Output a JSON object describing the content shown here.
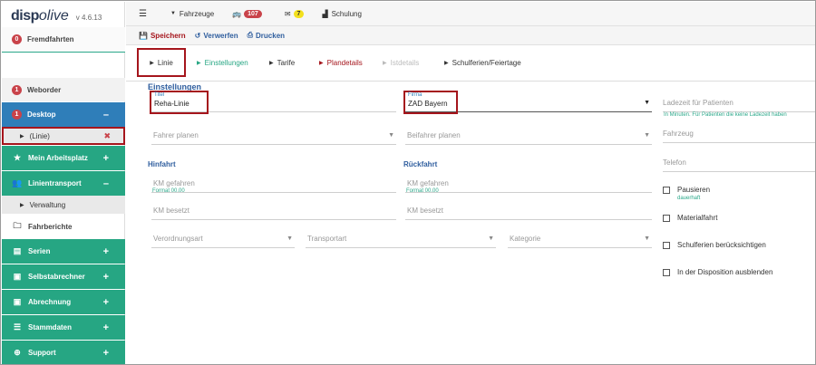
{
  "app": {
    "logo_disp": "disp",
    "logo_live": "olive",
    "version": "v 4.6.13"
  },
  "sidebar": {
    "fremdfahrten": {
      "badge": "0",
      "label": "Fremdfahrten"
    },
    "weborder": {
      "badge": "1",
      "label": "Weborder"
    },
    "desktop": {
      "badge": "1",
      "label": "Desktop",
      "toggle": "–"
    },
    "desktop_sub": {
      "label": "(Linie)",
      "close": "✖"
    },
    "mein_arbeitsplatz": {
      "label": "Mein Arbeitsplatz",
      "toggle": "+"
    },
    "linientransport": {
      "label": "Linientransport",
      "toggle": "–"
    },
    "verwaltung": {
      "label": "Verwaltung"
    },
    "fahrberichte": {
      "label": "Fahrberichte"
    },
    "serien": {
      "label": "Serien",
      "toggle": "+"
    },
    "selbstabrechner": {
      "label": "Selbstabrechner",
      "toggle": "+"
    },
    "abrechnung": {
      "label": "Abrechnung",
      "toggle": "+"
    },
    "stammdaten": {
      "label": "Stammdaten",
      "toggle": "+"
    },
    "support": {
      "label": "Support",
      "toggle": "+"
    }
  },
  "topbar": {
    "fahrzeuge": "Fahrzeuge",
    "bus_count": "107",
    "mail_count": "7",
    "schulung": "Schulung"
  },
  "actions": {
    "save": "Speichern",
    "discard": "Verwerfen",
    "print": "Drucken"
  },
  "tabs": {
    "linie": "Linie",
    "einstellungen": "Einstellungen",
    "tarife": "Tarife",
    "plandetails": "Plandetails",
    "istdetails": "Istdetails",
    "schulferien": "Schulferien/Feiertage"
  },
  "form": {
    "section_title": "Einstellungen",
    "titel_label": "Titel",
    "titel_value": "Reha-Linie",
    "firma_label": "Firma",
    "firma_value": "ZAD Bayern",
    "ladezeit_placeholder": "Ladezeit für Patienten",
    "ladezeit_hint": "In Minuten. Für Patienten die keine Ladezeit haben",
    "fahrer_placeholder": "Fahrer planen",
    "beifahrer_placeholder": "Beifahrer planen",
    "fahrzeug_placeholder": "Fahrzeug",
    "telefon_placeholder": "Telefon",
    "hinfahrt_title": "Hinfahrt",
    "rueckfahrt_title": "Rückfahrt",
    "km_gefahren_placeholder": "KM gefahren",
    "format_hint": "Format 00.00",
    "km_besetzt_placeholder": "KM besetzt",
    "verordnungsart_placeholder": "Verordnungsart",
    "transportart_placeholder": "Transportart",
    "kategorie_placeholder": "Kategorie",
    "pausieren_label": "Pausieren",
    "pausieren_hint": "dauerhaft",
    "materialfahrt_label": "Materialfahrt",
    "schulferien_label": "Schulferien berücksichtigen",
    "dispo_label": "In der Disposition ausblenden"
  },
  "colors": {
    "green": "#26a683",
    "blue": "#2f7eb9",
    "red": "#a5151c",
    "badge_red": "#c9434a"
  }
}
